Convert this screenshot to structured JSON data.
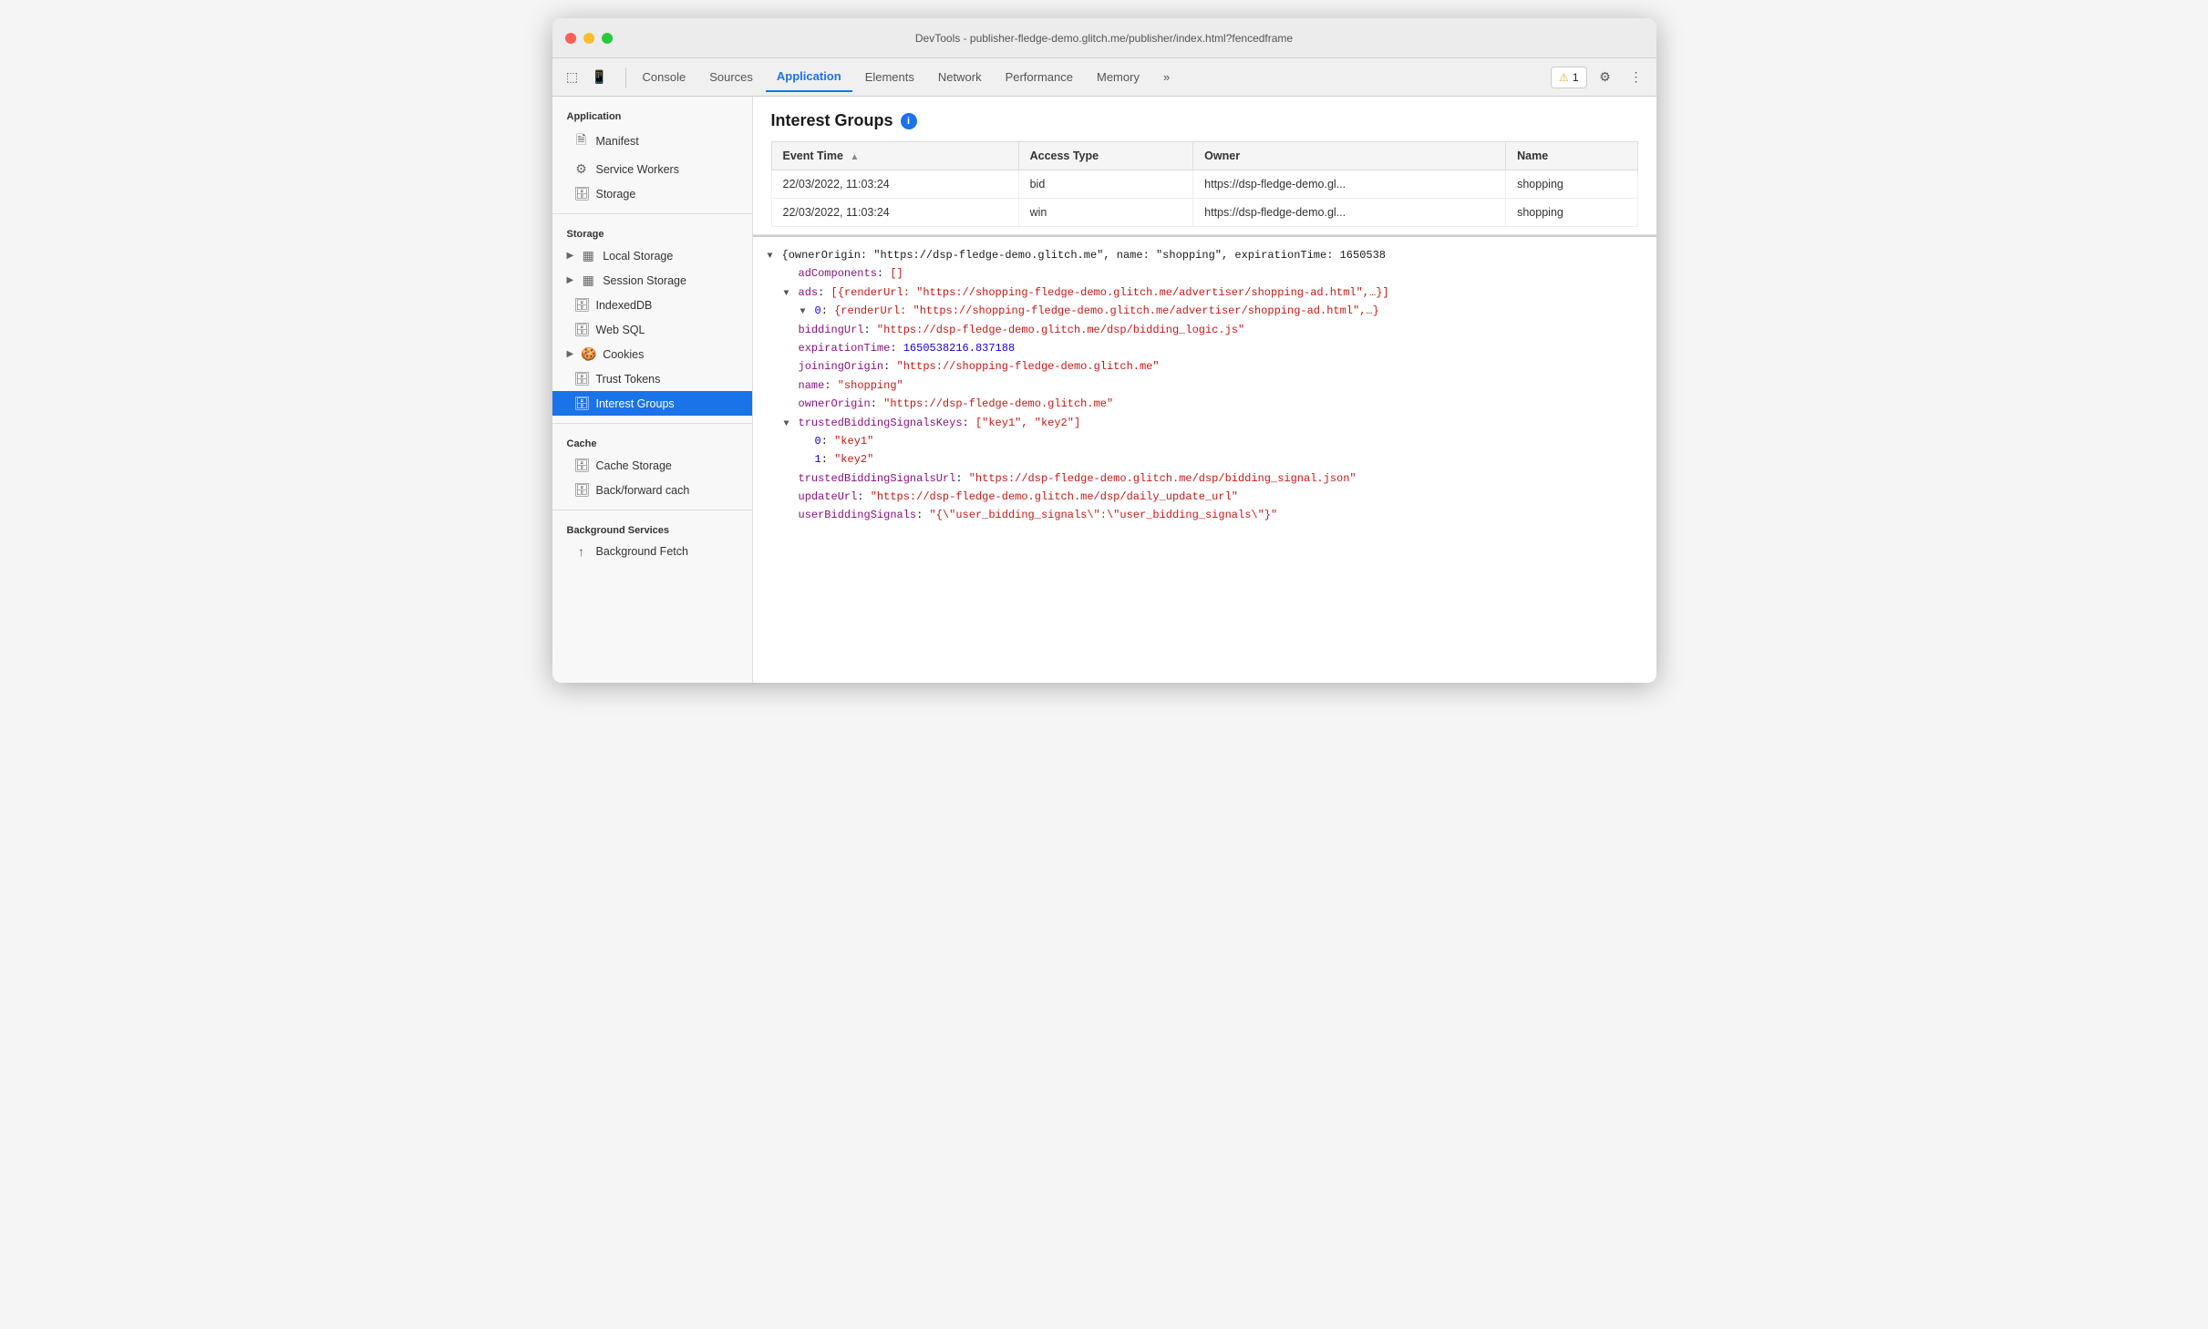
{
  "window": {
    "title": "DevTools - publisher-fledge-demo.glitch.me/publisher/index.html?fencedframe"
  },
  "toolbar": {
    "tabs": [
      {
        "id": "console",
        "label": "Console",
        "active": false
      },
      {
        "id": "sources",
        "label": "Sources",
        "active": false
      },
      {
        "id": "application",
        "label": "Application",
        "active": true
      },
      {
        "id": "elements",
        "label": "Elements",
        "active": false
      },
      {
        "id": "network",
        "label": "Network",
        "active": false
      },
      {
        "id": "performance",
        "label": "Performance",
        "active": false
      },
      {
        "id": "memory",
        "label": "Memory",
        "active": false
      }
    ],
    "more_label": "»",
    "warning_count": "1"
  },
  "sidebar": {
    "sections": [
      {
        "title": "Application",
        "items": [
          {
            "id": "manifest",
            "label": "Manifest",
            "icon": "📄",
            "expandable": false
          },
          {
            "id": "service-workers",
            "label": "Service Workers",
            "icon": "⚙️",
            "expandable": false
          },
          {
            "id": "storage",
            "label": "Storage",
            "icon": "🗄️",
            "expandable": false
          }
        ]
      },
      {
        "title": "Storage",
        "items": [
          {
            "id": "local-storage",
            "label": "Local Storage",
            "icon": "▦",
            "expandable": true
          },
          {
            "id": "session-storage",
            "label": "Session Storage",
            "icon": "▦",
            "expandable": true
          },
          {
            "id": "indexeddb",
            "label": "IndexedDB",
            "icon": "🗄️",
            "expandable": false
          },
          {
            "id": "web-sql",
            "label": "Web SQL",
            "icon": "🗄️",
            "expandable": false
          },
          {
            "id": "cookies",
            "label": "Cookies",
            "icon": "🍪",
            "expandable": true
          },
          {
            "id": "trust-tokens",
            "label": "Trust Tokens",
            "icon": "🗄️",
            "expandable": false
          },
          {
            "id": "interest-groups",
            "label": "Interest Groups",
            "icon": "🗄️",
            "expandable": false,
            "active": true
          }
        ]
      },
      {
        "title": "Cache",
        "items": [
          {
            "id": "cache-storage",
            "label": "Cache Storage",
            "icon": "🗄️",
            "expandable": false
          },
          {
            "id": "back-forward-cache",
            "label": "Back/forward cach",
            "icon": "🗄️",
            "expandable": false
          }
        ]
      },
      {
        "title": "Background Services",
        "items": [
          {
            "id": "background-fetch",
            "label": "Background Fetch",
            "icon": "↑",
            "expandable": false
          }
        ]
      }
    ]
  },
  "panel": {
    "title": "Interest Groups",
    "table": {
      "columns": [
        "Event Time",
        "Access Type",
        "Owner",
        "Name"
      ],
      "rows": [
        {
          "event_time": "22/03/2022, 11:03:24",
          "access_type": "bid",
          "owner": "https://dsp-fledge-demo.gl...",
          "name": "shopping"
        },
        {
          "event_time": "22/03/2022, 11:03:24",
          "access_type": "win",
          "owner": "https://dsp-fledge-demo.gl...",
          "name": "shopping"
        }
      ]
    },
    "detail": {
      "lines": [
        {
          "indent": 0,
          "expanded": true,
          "content": "{ownerOrigin: \"https://dsp-fledge-demo.glitch.me\", name: \"shopping\", expirationTime: 1650538"
        },
        {
          "indent": 1,
          "key": "adComponents",
          "value": "[]"
        },
        {
          "indent": 1,
          "expanded": true,
          "key": "ads",
          "value": "[{renderUrl: \"https://shopping-fledge-demo.glitch.me/advertiser/shopping-ad.html\",…}]"
        },
        {
          "indent": 2,
          "expanded": true,
          "key": "0",
          "value": "{renderUrl: \"https://shopping-fledge-demo.glitch.me/advertiser/shopping-ad.html\",…}"
        },
        {
          "indent": 1,
          "key": "biddingUrl",
          "value": "\"https://dsp-fledge-demo.glitch.me/dsp/bidding_logic.js\""
        },
        {
          "indent": 1,
          "key": "expirationTime",
          "value": "1650538216.837188"
        },
        {
          "indent": 1,
          "key": "joiningOrigin",
          "value": "\"https://shopping-fledge-demo.glitch.me\""
        },
        {
          "indent": 1,
          "key": "name",
          "value": "\"shopping\""
        },
        {
          "indent": 1,
          "key": "ownerOrigin",
          "value": "\"https://dsp-fledge-demo.glitch.me\""
        },
        {
          "indent": 1,
          "expanded": true,
          "key": "trustedBiddingSignalsKeys",
          "value": "[\"key1\", \"key2\"]"
        },
        {
          "indent": 2,
          "key": "0",
          "value": "\"key1\""
        },
        {
          "indent": 2,
          "key": "1",
          "value": "\"key2\""
        },
        {
          "indent": 1,
          "key": "trustedBiddingSignalsUrl",
          "value": "\"https://dsp-fledge-demo.glitch.me/dsp/bidding_signal.json\""
        },
        {
          "indent": 1,
          "key": "updateUrl",
          "value": "\"https://dsp-fledge-demo.glitch.me/dsp/daily_update_url\""
        },
        {
          "indent": 1,
          "key": "userBiddingSignals",
          "value": "\"{\\\"user_bidding_signals\\\":\\\"user_bidding_signals\\\"}\""
        }
      ]
    }
  }
}
